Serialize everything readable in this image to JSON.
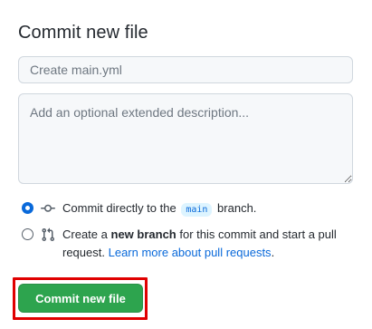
{
  "form": {
    "title": "Commit new file",
    "summary_placeholder": "Create main.yml",
    "description_placeholder": "Add an optional extended description..."
  },
  "options": {
    "direct": {
      "checked": true,
      "text_before": "Commit directly to the",
      "branch": "main",
      "text_after": "branch."
    },
    "new_branch": {
      "checked": false,
      "text_before": "Create a",
      "bold": "new branch",
      "text_after": "for this commit and start a pull request.",
      "link": "Learn more about pull requests",
      "period": "."
    }
  },
  "actions": {
    "commit_label": "Commit new file"
  },
  "colors": {
    "primary_button": "#2da44e",
    "link": "#0969da",
    "highlight": "#e00000"
  },
  "icons": {
    "direct": "git-commit-icon",
    "new_branch": "git-pull-request-icon"
  }
}
